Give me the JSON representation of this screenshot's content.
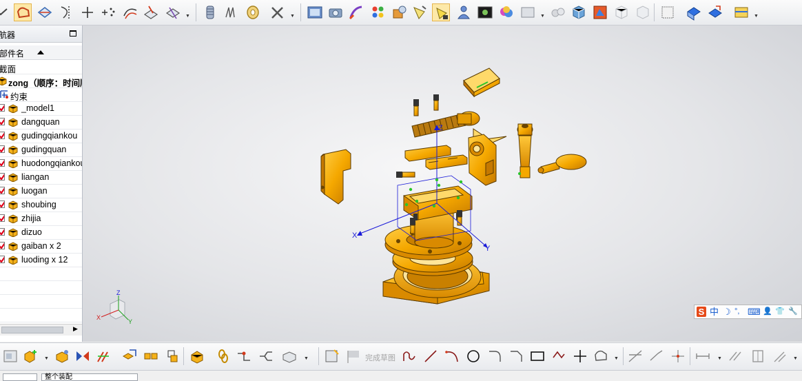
{
  "navigator": {
    "title": "航器",
    "column_header": "部件名",
    "nodes": [
      {
        "label": "截面",
        "checked": false,
        "icon": "none"
      },
      {
        "label": "zong（顺序：时间顺",
        "checked": false,
        "icon": "assembly-icon"
      },
      {
        "label": "约束",
        "checked": false,
        "icon": "constraints-icon"
      },
      {
        "label": "_model1",
        "checked": true,
        "icon": "part-cube-icon"
      },
      {
        "label": "dangquan",
        "checked": true,
        "icon": "part-cube-icon"
      },
      {
        "label": "gudingqiankou",
        "checked": true,
        "icon": "part-cube-icon"
      },
      {
        "label": "gudingquan",
        "checked": true,
        "icon": "part-cube-icon"
      },
      {
        "label": "huodongqiankou",
        "checked": true,
        "icon": "part-cube-icon"
      },
      {
        "label": "liangan",
        "checked": true,
        "icon": "part-cube-icon"
      },
      {
        "label": "luogan",
        "checked": true,
        "icon": "part-cube-icon"
      },
      {
        "label": "shoubing",
        "checked": true,
        "icon": "part-cube-icon"
      },
      {
        "label": "zhijia",
        "checked": true,
        "icon": "part-cube-icon"
      },
      {
        "label": "dizuo",
        "checked": true,
        "icon": "part-cube-icon"
      },
      {
        "label": "gaiban x 2",
        "checked": true,
        "icon": "part-cube-icon"
      },
      {
        "label": "luoding x 12",
        "checked": true,
        "icon": "part-cube-icon"
      }
    ]
  },
  "viewport": {
    "axis_labels": {
      "x": "X",
      "y": "Y",
      "z": "Z"
    },
    "triad_labels": {
      "x": "X",
      "y": "Y",
      "z": "Z"
    }
  },
  "ime": {
    "logo": "S",
    "mode": "中",
    "moon": "☽",
    "punct": "°,",
    "keyboard": "⌨",
    "user": "👤",
    "shirt": "👕",
    "tool": "🔧"
  },
  "bottom_toolbar": {
    "finish_sketch_label": "完成草图"
  },
  "status_bar": {
    "filter_value": "",
    "scope_value": "整个装配"
  },
  "colors": {
    "part_orange": "#f5a800",
    "part_dark": "#b06e00",
    "csys_blue": "#1a1ad8",
    "checkbox_red": "#e0001b",
    "viewport_light": "#f6f6f7",
    "viewport_dark": "#cfd1d6"
  }
}
